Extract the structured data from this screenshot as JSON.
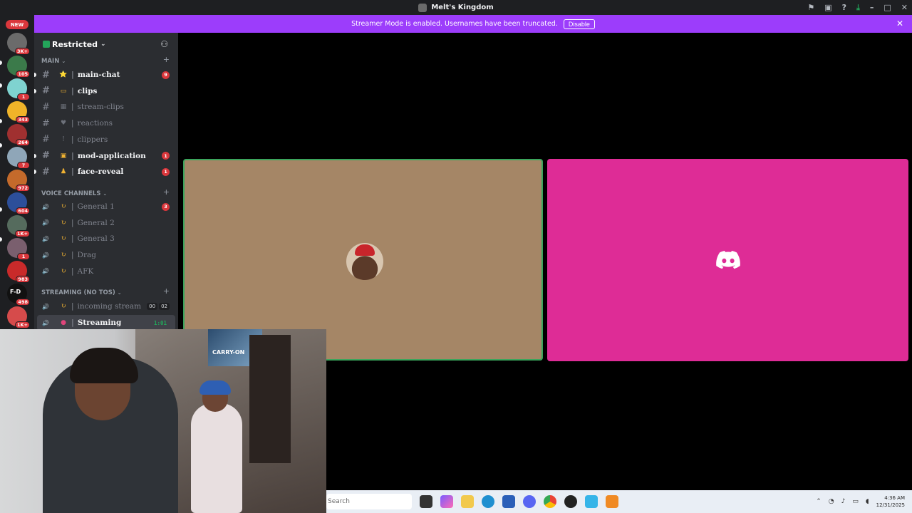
{
  "window": {
    "title": "Melt's Kingdom"
  },
  "banner": {
    "message": "Streamer Mode is enabled. Usernames have been truncated.",
    "disable_label": "Disable",
    "color": "#9c3dfb"
  },
  "rail": {
    "new_label": "NEW",
    "servers": [
      {
        "badge": "3K+",
        "color": "#6b6b6b"
      },
      {
        "badge": "105",
        "color": "#3b7a4a"
      },
      {
        "badge": "1",
        "color": "#7fd3d0"
      },
      {
        "badge": "343",
        "color": "#f0b429"
      },
      {
        "badge": "264",
        "color": "#a03030"
      },
      {
        "badge": "7",
        "color": "#8fa6b8"
      },
      {
        "badge": "972",
        "color": "#c46a2b"
      },
      {
        "badge": "604",
        "color": "#2d4f9a"
      },
      {
        "badge": "1K+",
        "color": "#556b5d"
      },
      {
        "badge": "1",
        "color": "#7a5f6e"
      },
      {
        "badge": "983",
        "color": "#c92a2a"
      },
      {
        "badge": "498",
        "color": "#111111",
        "glyph": "F-D"
      },
      {
        "badge": "1K+",
        "color": "#d64b4b"
      },
      {
        "badge": "",
        "color": "#3a4f8c"
      }
    ]
  },
  "sidebar": {
    "server_name": "Restricted",
    "categories": {
      "main": "MAIN",
      "voice": "VOICE CHANNELS",
      "streaming": "STREAMING (NO TOS)"
    },
    "text_channels": [
      {
        "name": "main-chat",
        "unread": true,
        "badge": "9",
        "emoji": "⭐"
      },
      {
        "name": "clips",
        "unread": true,
        "badge": "",
        "emoji": "▭"
      },
      {
        "name": "stream-clips",
        "unread": false,
        "badge": "",
        "emoji": "▦"
      },
      {
        "name": "reactions",
        "unread": false,
        "badge": "",
        "emoji": "♥"
      },
      {
        "name": "clippers",
        "unread": false,
        "badge": "",
        "emoji": "!"
      },
      {
        "name": "mod-application",
        "unread": true,
        "badge": "1",
        "emoji": "▣"
      },
      {
        "name": "face-reveal",
        "unread": true,
        "badge": "1",
        "emoji": "♟"
      }
    ],
    "voice_channels": [
      {
        "name": "General 1",
        "badge": "3"
      },
      {
        "name": "General 2",
        "badge": ""
      },
      {
        "name": "General 3",
        "badge": ""
      },
      {
        "name": "Drag",
        "badge": ""
      },
      {
        "name": "AFK",
        "badge": ""
      }
    ],
    "streaming_channels": [
      {
        "name": "incoming stream",
        "count_a": "00",
        "count_b": "02"
      },
      {
        "name": "Streaming",
        "timer": "1:01"
      }
    ]
  },
  "stage": {
    "user_tile_color": "#a58666",
    "logo_tile_color": "#de2c96",
    "speaking_border": "#3ba55c"
  },
  "webcam": {
    "poster_text": "CARRY-ON"
  },
  "taskbar": {
    "search_placeholder": "Search",
    "time": "4:36 AM",
    "date": "12/31/2025"
  }
}
